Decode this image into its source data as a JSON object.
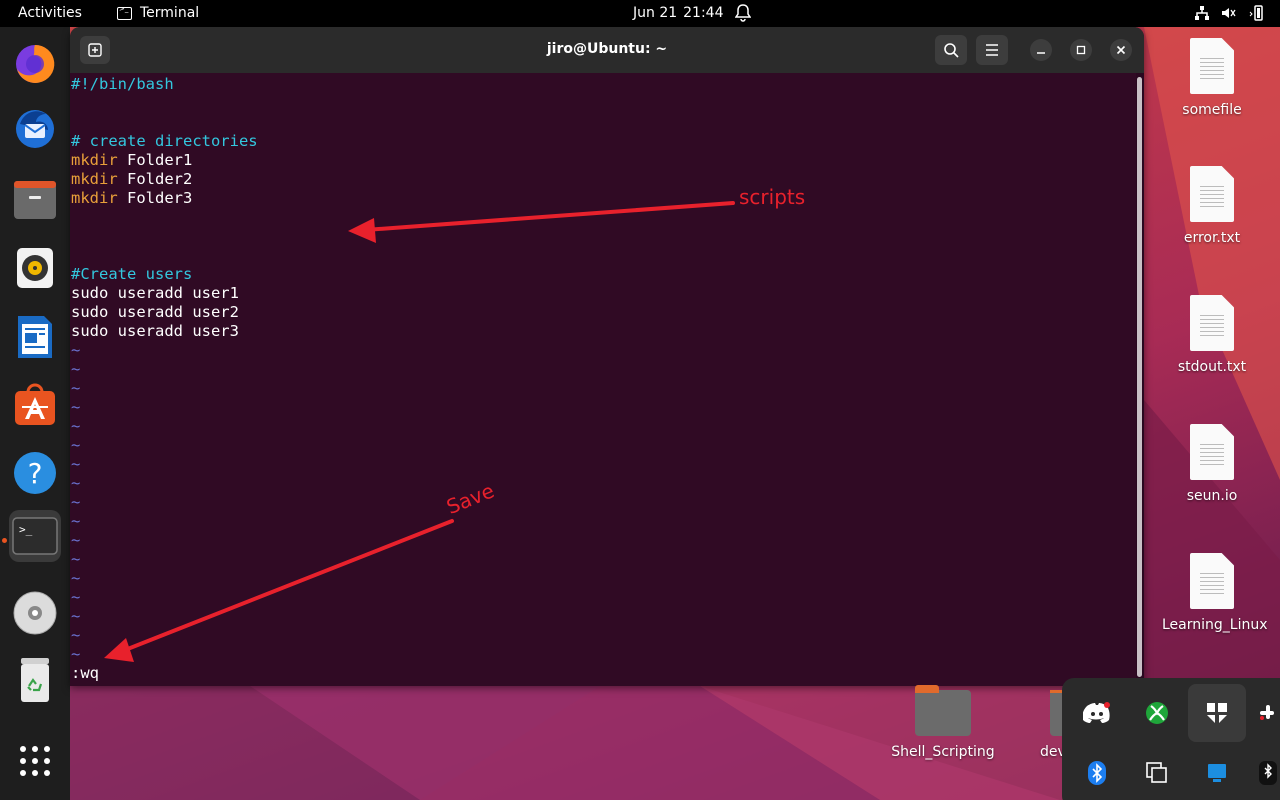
{
  "topbar": {
    "activities": "Activities",
    "app_name": "Terminal",
    "date": "Jun 21",
    "time": "21:44"
  },
  "dock": {
    "items": [
      {
        "name": "firefox-icon"
      },
      {
        "name": "thunderbird-icon"
      },
      {
        "name": "files-icon"
      },
      {
        "name": "rhythmbox-icon"
      },
      {
        "name": "libreoffice-writer-icon"
      },
      {
        "name": "app-center-icon"
      },
      {
        "name": "help-icon"
      },
      {
        "name": "terminal-icon"
      },
      {
        "name": "disc-icon"
      },
      {
        "name": "trash-icon"
      },
      {
        "name": "show-apps-icon"
      }
    ]
  },
  "terminal": {
    "title": "jiro@Ubuntu: ~",
    "lines": [
      {
        "text": "#!/bin/bash",
        "type": "comment"
      },
      {
        "text": "",
        "type": "plain"
      },
      {
        "text": "",
        "type": "plain"
      },
      {
        "text": "# create directories",
        "type": "comment"
      },
      {
        "kw": "mkdir",
        "rest": " Folder1",
        "type": "cmd"
      },
      {
        "kw": "mkdir",
        "rest": " Folder2",
        "type": "cmd"
      },
      {
        "kw": "mkdir",
        "rest": " Folder3",
        "type": "cmd"
      },
      {
        "text": "",
        "type": "plain"
      },
      {
        "text": "",
        "type": "plain"
      },
      {
        "text": "",
        "type": "plain"
      },
      {
        "text": "#Create users",
        "type": "comment"
      },
      {
        "text": "sudo useradd user1",
        "type": "plain"
      },
      {
        "text": "sudo useradd user2",
        "type": "plain"
      },
      {
        "text": "sudo useradd user3",
        "type": "plain"
      }
    ],
    "tilde": "~",
    "tilde_count": 17,
    "command_line": ":wq"
  },
  "desktop": {
    "files": [
      "somefile",
      "error.txt",
      "stdout.txt",
      "seun.io",
      "Learning_Linux"
    ],
    "folders": [
      "Shell_Scripting",
      "dev"
    ]
  },
  "annotations": {
    "scripts_label": "scripts",
    "save_label": "Save",
    "color": "#e8212c"
  },
  "colors": {
    "terminal_bg": "#300a24",
    "comment": "#33c7de",
    "keyword": "#e9a03a",
    "tilde": "#6c74d4",
    "accent": "#e95420"
  }
}
